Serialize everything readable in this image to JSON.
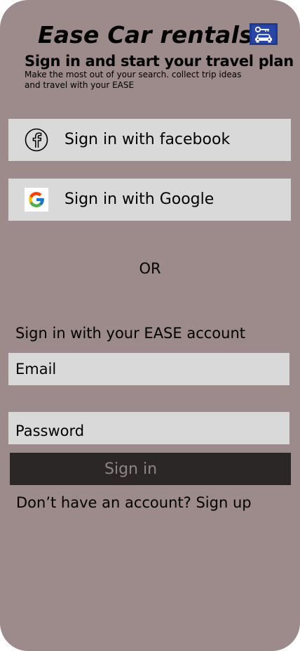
{
  "app": {
    "title": "Ease Car rentals",
    "logo_icon": "car-key-icon",
    "logo_color": "#1f3a93"
  },
  "intro": {
    "headline": "Sign in and start your travel plan",
    "subtext": "Make the most out of your search. collect trip ideas and travel with your EASE"
  },
  "social": {
    "facebook": {
      "label": "Sign in with facebook",
      "icon": "facebook-icon"
    },
    "google": {
      "label": "Sign in with Google",
      "icon": "google-icon"
    }
  },
  "divider": {
    "label": "OR"
  },
  "account": {
    "heading": "Sign in with your EASE account",
    "email_placeholder": "Email",
    "password_placeholder": "Password",
    "submit_label": "Sign in"
  },
  "signup": {
    "prompt": "Don’t have an account?",
    "link_label": "Sign up"
  },
  "colors": {
    "background": "#9d8a8a",
    "button_bg": "#d9d9d9",
    "primary_button_bg": "#2b2727",
    "primary_button_text": "#8f8585"
  }
}
